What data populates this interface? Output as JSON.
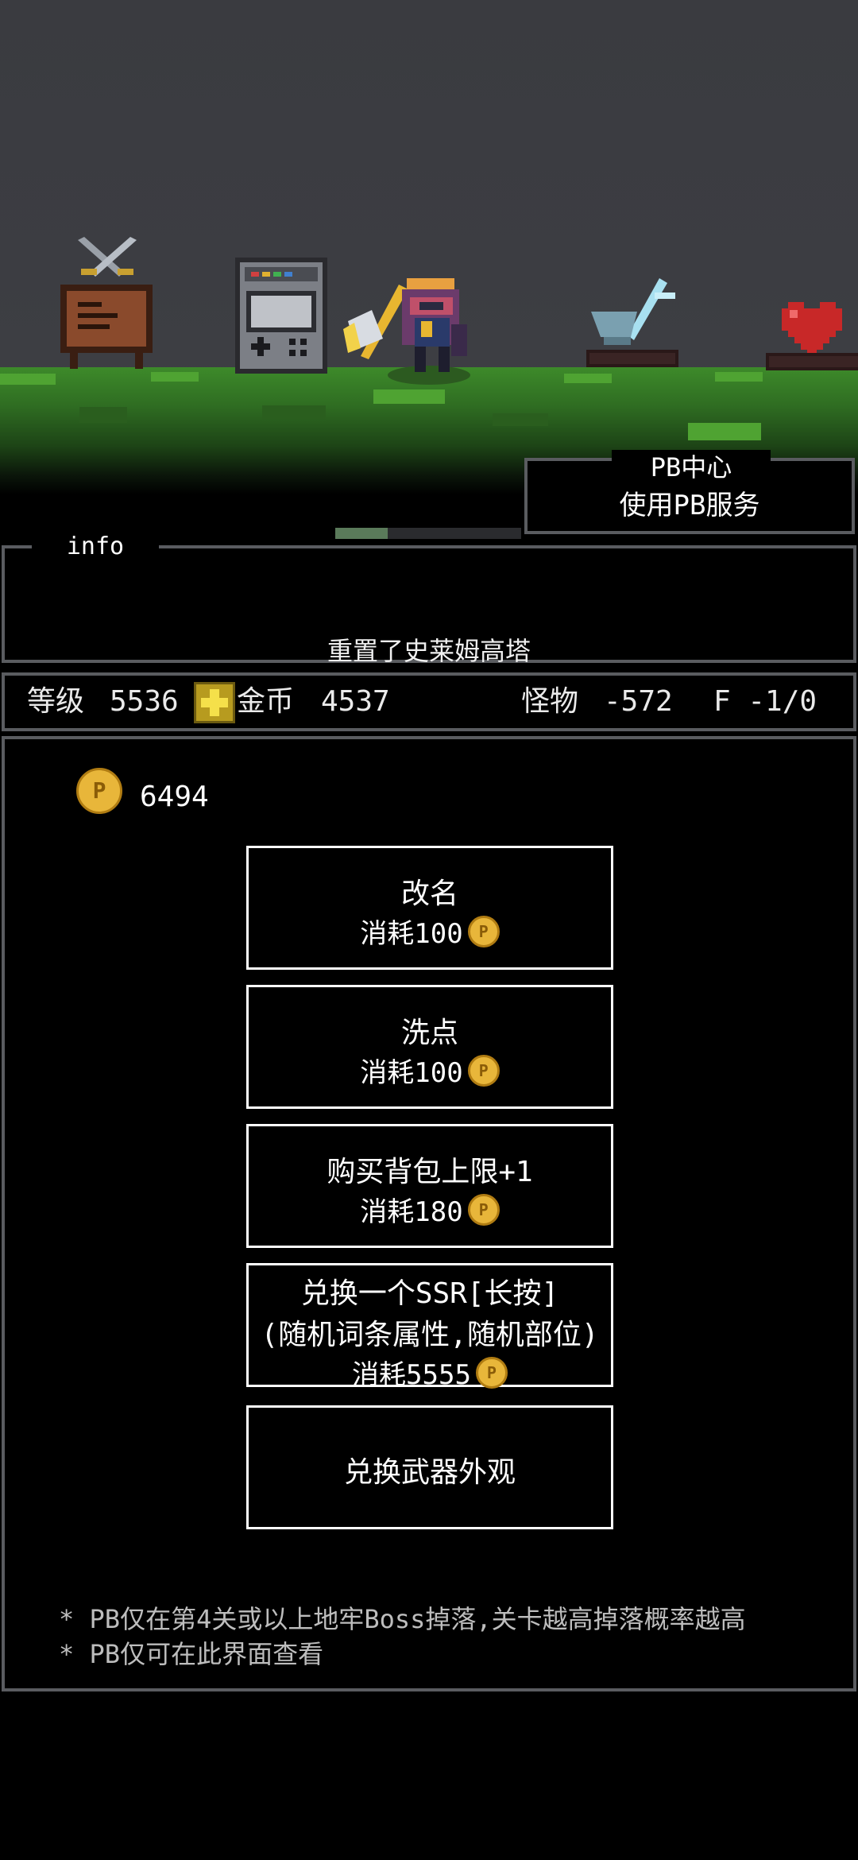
{
  "pb_center": {
    "title": "PB中心",
    "subtitle": "使用PB服务",
    "progress": 0.28
  },
  "info": {
    "label": "info",
    "message": "重置了史莱姆高塔"
  },
  "stats": {
    "level_label": "等级",
    "level": "5536",
    "gold_label": "金币",
    "gold": "4537",
    "monster_label": "怪物",
    "monster": "-572",
    "floor": "F -1/0"
  },
  "pb_balance": "6494",
  "coin_glyph": "P",
  "actions": [
    {
      "title": "改名",
      "cost": "消耗100"
    },
    {
      "title": "洗点",
      "cost": "消耗100"
    },
    {
      "title": "购买背包上限+1",
      "cost": "消耗180"
    },
    {
      "title": "兑换一个SSR[长按]",
      "subtitle": "(随机词条属性,随机部位)",
      "cost": "消耗5555"
    },
    {
      "title": "兑换武器外观"
    }
  ],
  "notes": [
    "* PB仅在第4关或以上地牢Boss掉落,关卡越高掉落概率越高",
    "* PB仅可在此界面查看"
  ],
  "colors": {
    "coin": "#e8b63a",
    "border": "#5a5c60",
    "grass": "#3d8a2a"
  },
  "icons": [
    "crossed-swords-icon",
    "notice-board-icon",
    "arcade-machine-icon",
    "hero-character",
    "anvil-hammer-icon",
    "heart-icon",
    "plus-icon",
    "pb-coin-icon"
  ]
}
